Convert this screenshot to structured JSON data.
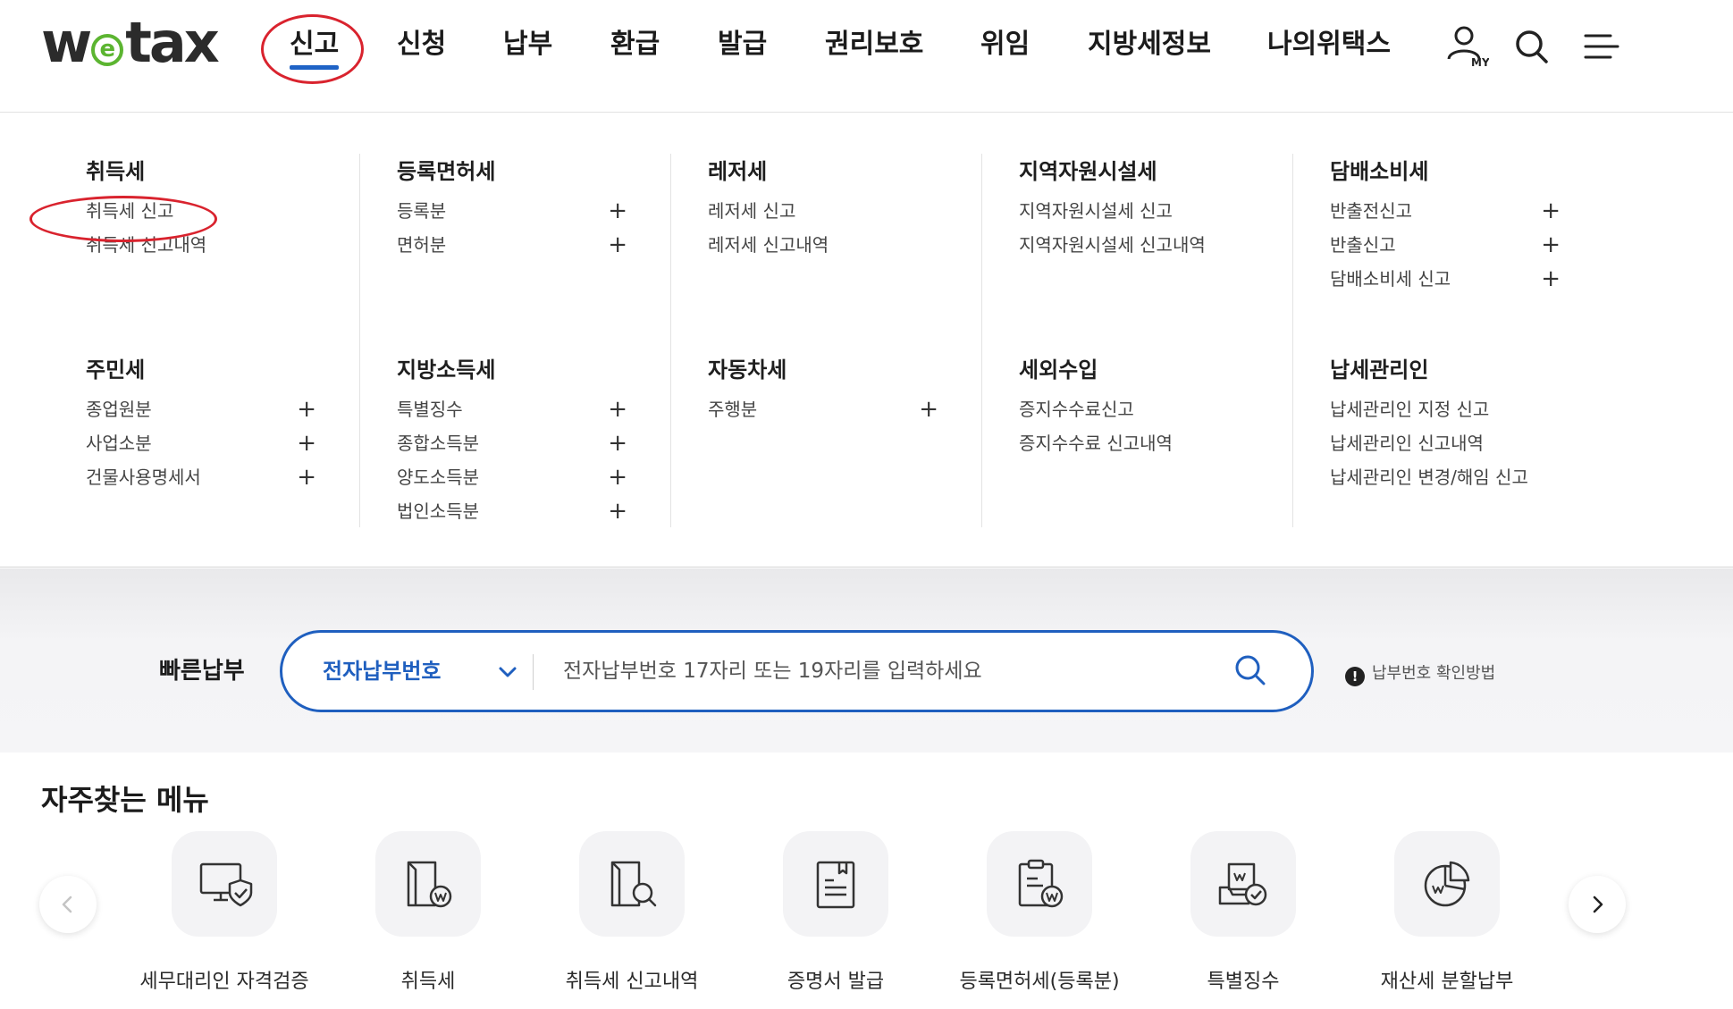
{
  "logo": {
    "prefix": "w",
    "e": "e",
    "suffix": "tax"
  },
  "nav": {
    "items": [
      "신고",
      "신청",
      "납부",
      "환급",
      "발급",
      "권리보호",
      "위임",
      "지방세정보",
      "나의위택스"
    ],
    "active": "신고",
    "my_label": "MY"
  },
  "mega_menu": {
    "groups": [
      {
        "title": "취득세",
        "items": [
          {
            "label": "취득세 신고",
            "plus": ""
          },
          {
            "label": "취득세 신고내역",
            "plus": ""
          }
        ]
      },
      {
        "title": "등록면허세",
        "items": [
          {
            "label": "등록분",
            "plus": "+"
          },
          {
            "label": "면허분",
            "plus": "+"
          }
        ]
      },
      {
        "title": "레저세",
        "items": [
          {
            "label": "레저세 신고",
            "plus": ""
          },
          {
            "label": "레저세 신고내역",
            "plus": ""
          }
        ]
      },
      {
        "title": "지역자원시설세",
        "items": [
          {
            "label": "지역자원시설세 신고",
            "plus": ""
          },
          {
            "label": "지역자원시설세 신고내역",
            "plus": ""
          }
        ]
      },
      {
        "title": "담배소비세",
        "items": [
          {
            "label": "반출전신고",
            "plus": "+"
          },
          {
            "label": "반출신고",
            "plus": "+"
          },
          {
            "label": "담배소비세 신고",
            "plus": "+"
          }
        ]
      },
      {
        "title": "주민세",
        "items": [
          {
            "label": "종업원분",
            "plus": "+"
          },
          {
            "label": "사업소분",
            "plus": "+"
          },
          {
            "label": "건물사용명세서",
            "plus": "+"
          }
        ]
      },
      {
        "title": "지방소득세",
        "items": [
          {
            "label": "특별징수",
            "plus": "+"
          },
          {
            "label": "종합소득분",
            "plus": "+"
          },
          {
            "label": "양도소득분",
            "plus": "+"
          },
          {
            "label": "법인소득분",
            "plus": "+"
          }
        ]
      },
      {
        "title": "자동차세",
        "items": [
          {
            "label": "주행분",
            "plus": "+"
          }
        ]
      },
      {
        "title": "세외수입",
        "items": [
          {
            "label": "증지수수료신고",
            "plus": ""
          },
          {
            "label": "증지수수료 신고내역",
            "plus": ""
          }
        ]
      },
      {
        "title": "납세관리인",
        "items": [
          {
            "label": "납세관리인 지정 신고",
            "plus": ""
          },
          {
            "label": "납세관리인 신고내역",
            "plus": ""
          },
          {
            "label": "납세관리인 변경/해임 신고",
            "plus": ""
          }
        ]
      }
    ]
  },
  "quick_pay": {
    "label": "빠른납부",
    "select_value": "전자납부번호",
    "placeholder": "전자납부번호 17자리 또는 19자리를 입력하세요",
    "help_text": "납부번호 확인방법",
    "help_icon": "!"
  },
  "frequent_menu": {
    "title": "자주찾는 메뉴",
    "items": [
      {
        "label": "세무대리인 자격검증",
        "icon": "monitor-shield-icon"
      },
      {
        "label": "취득세",
        "icon": "document-won-icon"
      },
      {
        "label": "취득세 신고내역",
        "icon": "document-search-icon"
      },
      {
        "label": "증명서 발급",
        "icon": "certificate-icon"
      },
      {
        "label": "등록면허세(등록분)",
        "icon": "clipboard-won-icon"
      },
      {
        "label": "특별징수",
        "icon": "tray-check-icon"
      },
      {
        "label": "재산세 분할납부",
        "icon": "pie-chart-won-icon"
      }
    ]
  },
  "colors": {
    "accent_blue": "#1f5fbf",
    "annotation_red": "#d9232e",
    "logo_green": "#5cb531"
  }
}
